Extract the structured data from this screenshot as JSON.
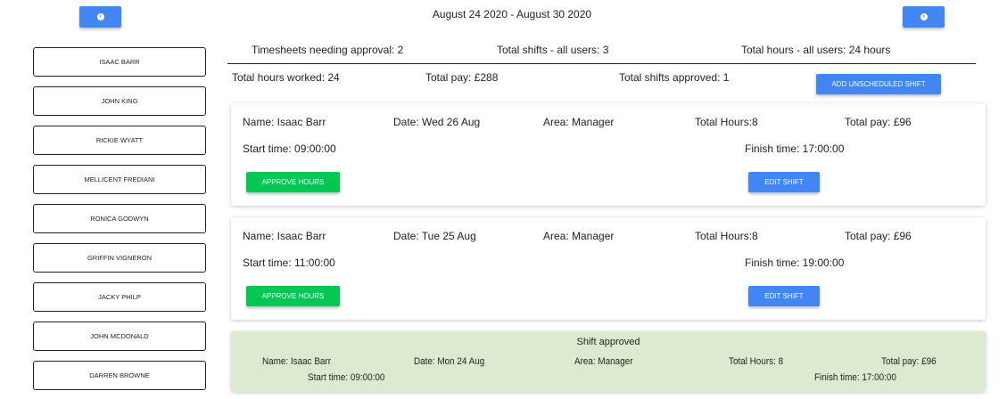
{
  "header": {
    "date_range": "August 24 2020 - August 30 2020",
    "prev_icon": "chevron-left-circle-icon",
    "next_icon": "chevron-right-circle-icon"
  },
  "users": [
    "ISAAC BARR",
    "JOHN KING",
    "RICKIE WYATT",
    "MELLICENT FREDIANI",
    "RONICA GODWYN",
    "GRIFFIN VIGNERON",
    "JACKY PHILP",
    "JOHN MCDONALD",
    "DARREN BROWNE"
  ],
  "summary": {
    "needing_approval": "Timesheets needing approval: 2",
    "total_shifts": "Total shifts - all users: 3",
    "total_hours_all": "Total hours - all users: 24 hours",
    "hours_worked": "Total hours worked: 24",
    "total_pay": "Total pay: £288",
    "shifts_approved": "Total shifts approved: 1",
    "add_button": "ADD UNSCHEDULED SHIFT"
  },
  "shifts": [
    {
      "name": "Name: Isaac Barr",
      "date": "Date: Wed 26 Aug",
      "area": "Area: Manager",
      "hours": "Total Hours:8",
      "pay": "Total pay: £96",
      "start": "Start time: 09:00:00",
      "finish": "Finish time: 17:00:00",
      "approve": "APPROVE HOURS",
      "edit": "EDIT SHIFT"
    },
    {
      "name": "Name: Isaac Barr",
      "date": "Date: Tue 25 Aug",
      "area": "Area: Manager",
      "hours": "Total Hours:8",
      "pay": "Total pay: £96",
      "start": "Start time: 11:00:00",
      "finish": "Finish time: 19:00:00",
      "approve": "APPROVE HOURS",
      "edit": "EDIT SHIFT"
    }
  ],
  "approved_shift": {
    "status": "Shift approved",
    "name": "Name: Isaac Barr",
    "date": "Date: Mon 24 Aug",
    "area": "Area: Manager",
    "hours": "Total Hours: 8",
    "pay": "Total pay: £96",
    "start": "Start time: 09:00:00",
    "finish": "Finish time: 17:00:00"
  }
}
